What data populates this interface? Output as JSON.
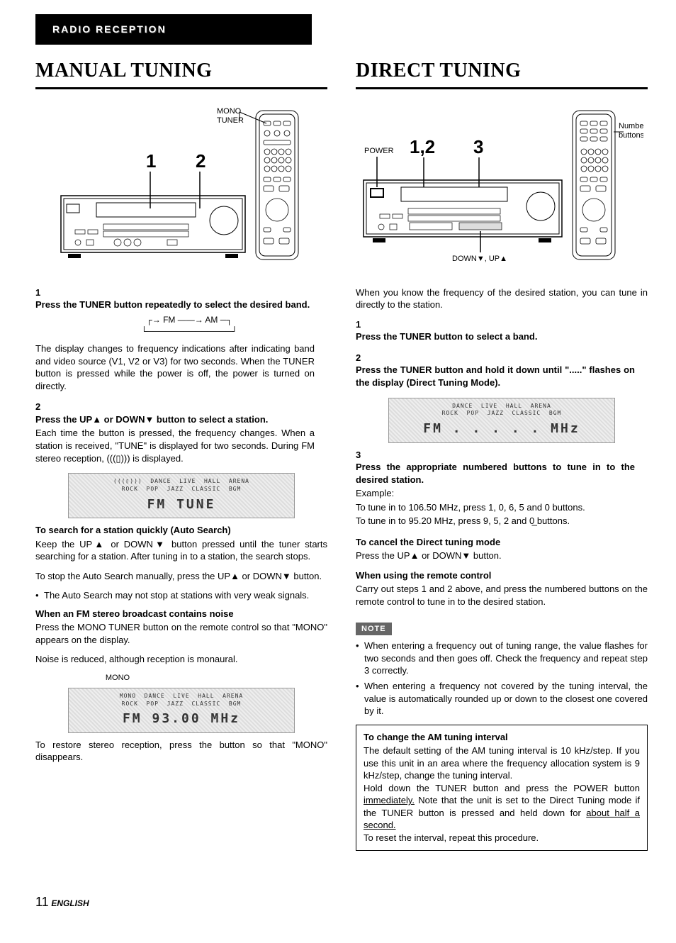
{
  "header": "RADIO RECEPTION",
  "left": {
    "title": "MANUAL TUNING",
    "fig": {
      "mono": "MONO",
      "tuner": "TUNER",
      "n1": "1",
      "n2": "2"
    },
    "s1": {
      "num": "1",
      "title": "Press the TUNER button repeatedly to select the desired band.",
      "fmam": "→ FM ——→ AM —",
      "text": "The display changes to frequency indications after indicating band and video source (V1, V2 or V3) for two seconds. When the TUNER button is pressed while the power is off, the power is turned on directly."
    },
    "s2": {
      "num": "2",
      "title": "Press the UP▲ or DOWN▼ button to select a station.",
      "text": "Each time the button is pressed, the frequency changes. When a station is received, \"TUNE\" is displayed for two seconds. During FM stereo reception, (((▯))) is displayed."
    },
    "disp1": {
      "top": "(((▯)))  DANCE  LIVE  HALL  ARENA\nROCK  POP  JAZZ  CLASSIC  BGM",
      "main": "FM   TUNE"
    },
    "auto": {
      "h": "To search for a station quickly (Auto Search)",
      "p1": "Keep the UP▲ or DOWN▼ button pressed until the tuner starts searching for a station. After tuning in to a station, the search stops.",
      "p2": "To stop the Auto Search manually, press the UP▲ or DOWN▼ button.",
      "b1": "The Auto Search may not stop at stations with very weak signals."
    },
    "noise": {
      "h": "When an FM stereo broadcast contains noise",
      "p1": "Press the MONO TUNER button on the remote control so that \"MONO\" appears on the display.",
      "p2": "Noise is reduced, although reception is monaural."
    },
    "monolbl": "MONO",
    "disp2": {
      "top": "MONO  DANCE  LIVE  HALL  ARENA\nROCK  POP  JAZZ  CLASSIC  BGM",
      "main": "FM   93.00 MHz"
    },
    "restore": "To restore stereo reception, press the button so that \"MONO\" disappears."
  },
  "right": {
    "title": "DIRECT TUNING",
    "fig": {
      "power": "POWER",
      "n12": "1,2",
      "n3": "3",
      "numbtn": "Numbered buttons",
      "downup": "DOWN▼, UP▲"
    },
    "intro": "When you know the frequency of the desired station, you can tune in directly to the station.",
    "s1": {
      "num": "1",
      "title": "Press the TUNER button to select a band."
    },
    "s2": {
      "num": "2",
      "title": "Press the TUNER button and hold it down until \".....\" flashes on the display (Direct Tuning Mode)."
    },
    "disp": {
      "top": "DANCE  LIVE  HALL  ARENA\nROCK  POP  JAZZ  CLASSIC  BGM",
      "main": "FM   . . . . .  MHz"
    },
    "s3": {
      "num": "3",
      "title": "Press the appropriate numbered buttons to tune in to the desired station.",
      "ex": "Example:",
      "l1": "To tune in to 106.50 MHz, press 1, 0, 6, 5 and 0 buttons.",
      "l2": "To tune in to 95.20 MHz, press 9, 5, 2 and 0̲ buttons."
    },
    "cancel": {
      "h": "To cancel the Direct tuning mode",
      "t": "Press the UP▲ or DOWN▼ button."
    },
    "remote": {
      "h": "When using the remote control",
      "t": "Carry out steps 1 and 2 above, and press the numbered buttons on the remote control to tune in to the desired station."
    },
    "note": "NOTE",
    "nb1": "When entering a frequency out of tuning range, the value flashes for two seconds and then goes off. Check the frequency and repeat step 3 correctly.",
    "nb2": "When entering a frequency not covered by the tuning interval, the value is automatically rounded up or down to the closest one covered by it.",
    "box": {
      "h": "To change the AM tuning interval",
      "p1": "The default setting of the AM tuning interval is 10 kHz/step. If you use this unit in an area where the frequency allocation system is 9 kHz/step, change the tuning interval.",
      "p2a": "Hold down the TUNER button and press the POWER button ",
      "p2u1": "immediately.",
      "p2b": " Note that the unit is set to the Direct Tuning mode if the TUNER button is pressed and held down for ",
      "p2u2": "about half a second.",
      "p3": "To reset the interval, repeat this procedure."
    }
  },
  "footer": {
    "page": "11",
    "lang": "ENGLISH"
  }
}
